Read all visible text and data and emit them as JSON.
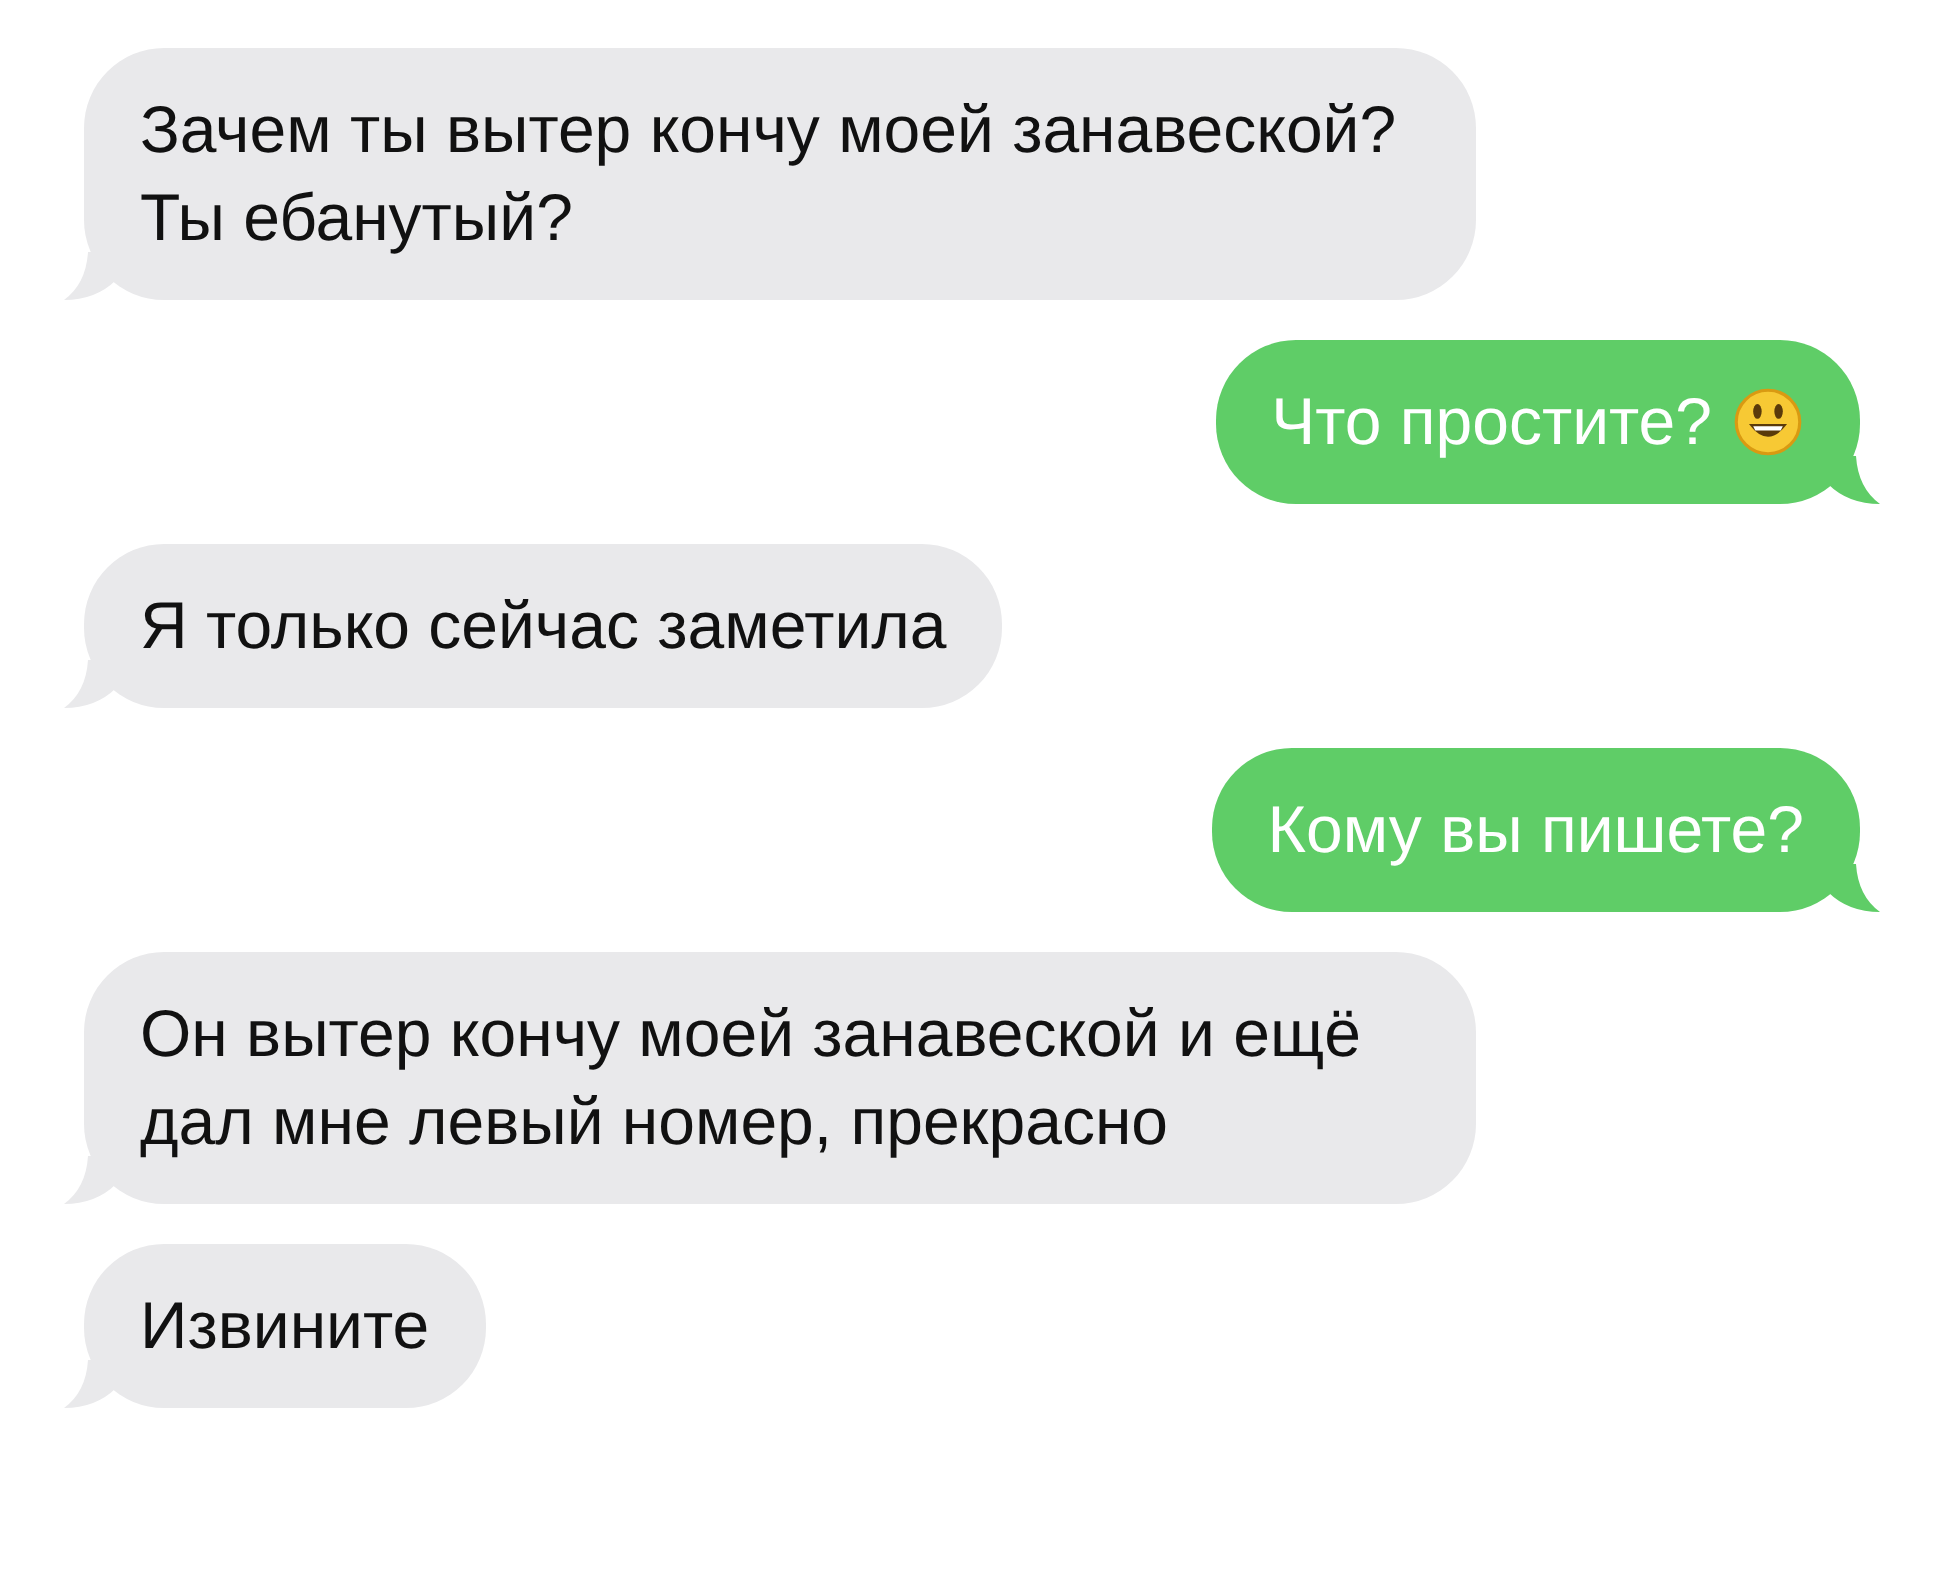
{
  "messages": [
    {
      "kind": "incoming",
      "text": "Зачем ты вытер кончу моей занавеской? Ты ебанутый?",
      "emoji": false
    },
    {
      "kind": "outgoing",
      "text": "Что простите?",
      "emoji": true
    },
    {
      "kind": "incoming",
      "text": "Я только сейчас заметила",
      "emoji": false
    },
    {
      "kind": "outgoing",
      "text": "Кому вы пишете?",
      "emoji": false
    },
    {
      "kind": "incoming",
      "text": "Он вытер кончу моей занавеской и ещё дал мне левый номер, прекрасно",
      "emoji": false
    },
    {
      "kind": "incoming",
      "text": "Извините",
      "emoji": false
    }
  ]
}
